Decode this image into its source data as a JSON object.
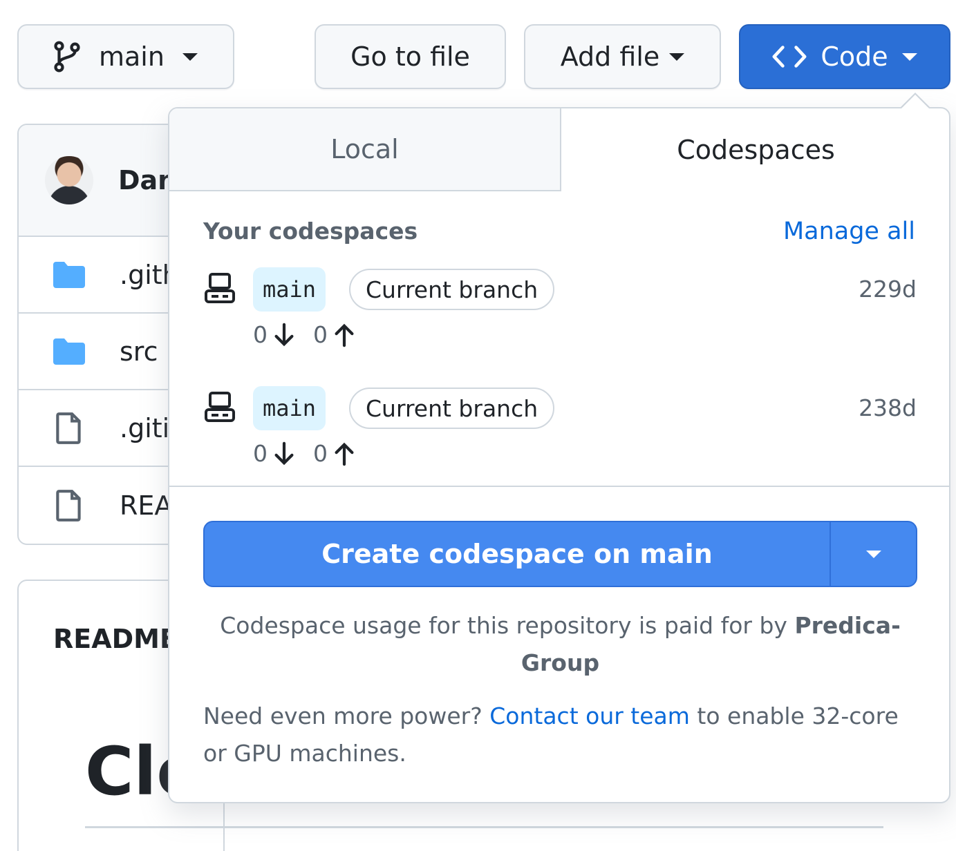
{
  "toolbar": {
    "branch_label": "main",
    "goto_label": "Go to file",
    "add_label": "Add file",
    "code_label": "Code"
  },
  "filebox": {
    "author": "Dan",
    "files": [
      {
        "name": ".gith",
        "icon": "folder-icon"
      },
      {
        "name": "src",
        "icon": "folder-icon"
      },
      {
        "name": ".giti",
        "icon": "file-icon"
      },
      {
        "name": "REA",
        "icon": "file-icon"
      }
    ],
    "readme_label": "README",
    "readme_heading": "Clo"
  },
  "popover": {
    "tabs": [
      "Local",
      "Codespaces"
    ],
    "active_tab": "Codespaces",
    "section_title": "Your codespaces",
    "manage_all": "Manage all",
    "codespaces": [
      {
        "branch": "main",
        "badge": "Current branch",
        "age": "229d",
        "behind": "0",
        "ahead": "0"
      },
      {
        "branch": "main",
        "badge": "Current branch",
        "age": "238d",
        "behind": "0",
        "ahead": "0"
      }
    ],
    "create_label": "Create codespace on main",
    "billing_text": "Codespace usage for this repository is paid for by ",
    "billing_org": "Predica-Group",
    "power_prefix": "Need even more power? ",
    "power_link": "Contact our team",
    "power_suffix": " to enable 32-core or GPU machines."
  },
  "colors": {
    "accent_blue": "#2b6fd6",
    "create_button": "#4589f0",
    "link": "#0969da",
    "folder": "#54aeff",
    "border": "#d0d7de"
  }
}
